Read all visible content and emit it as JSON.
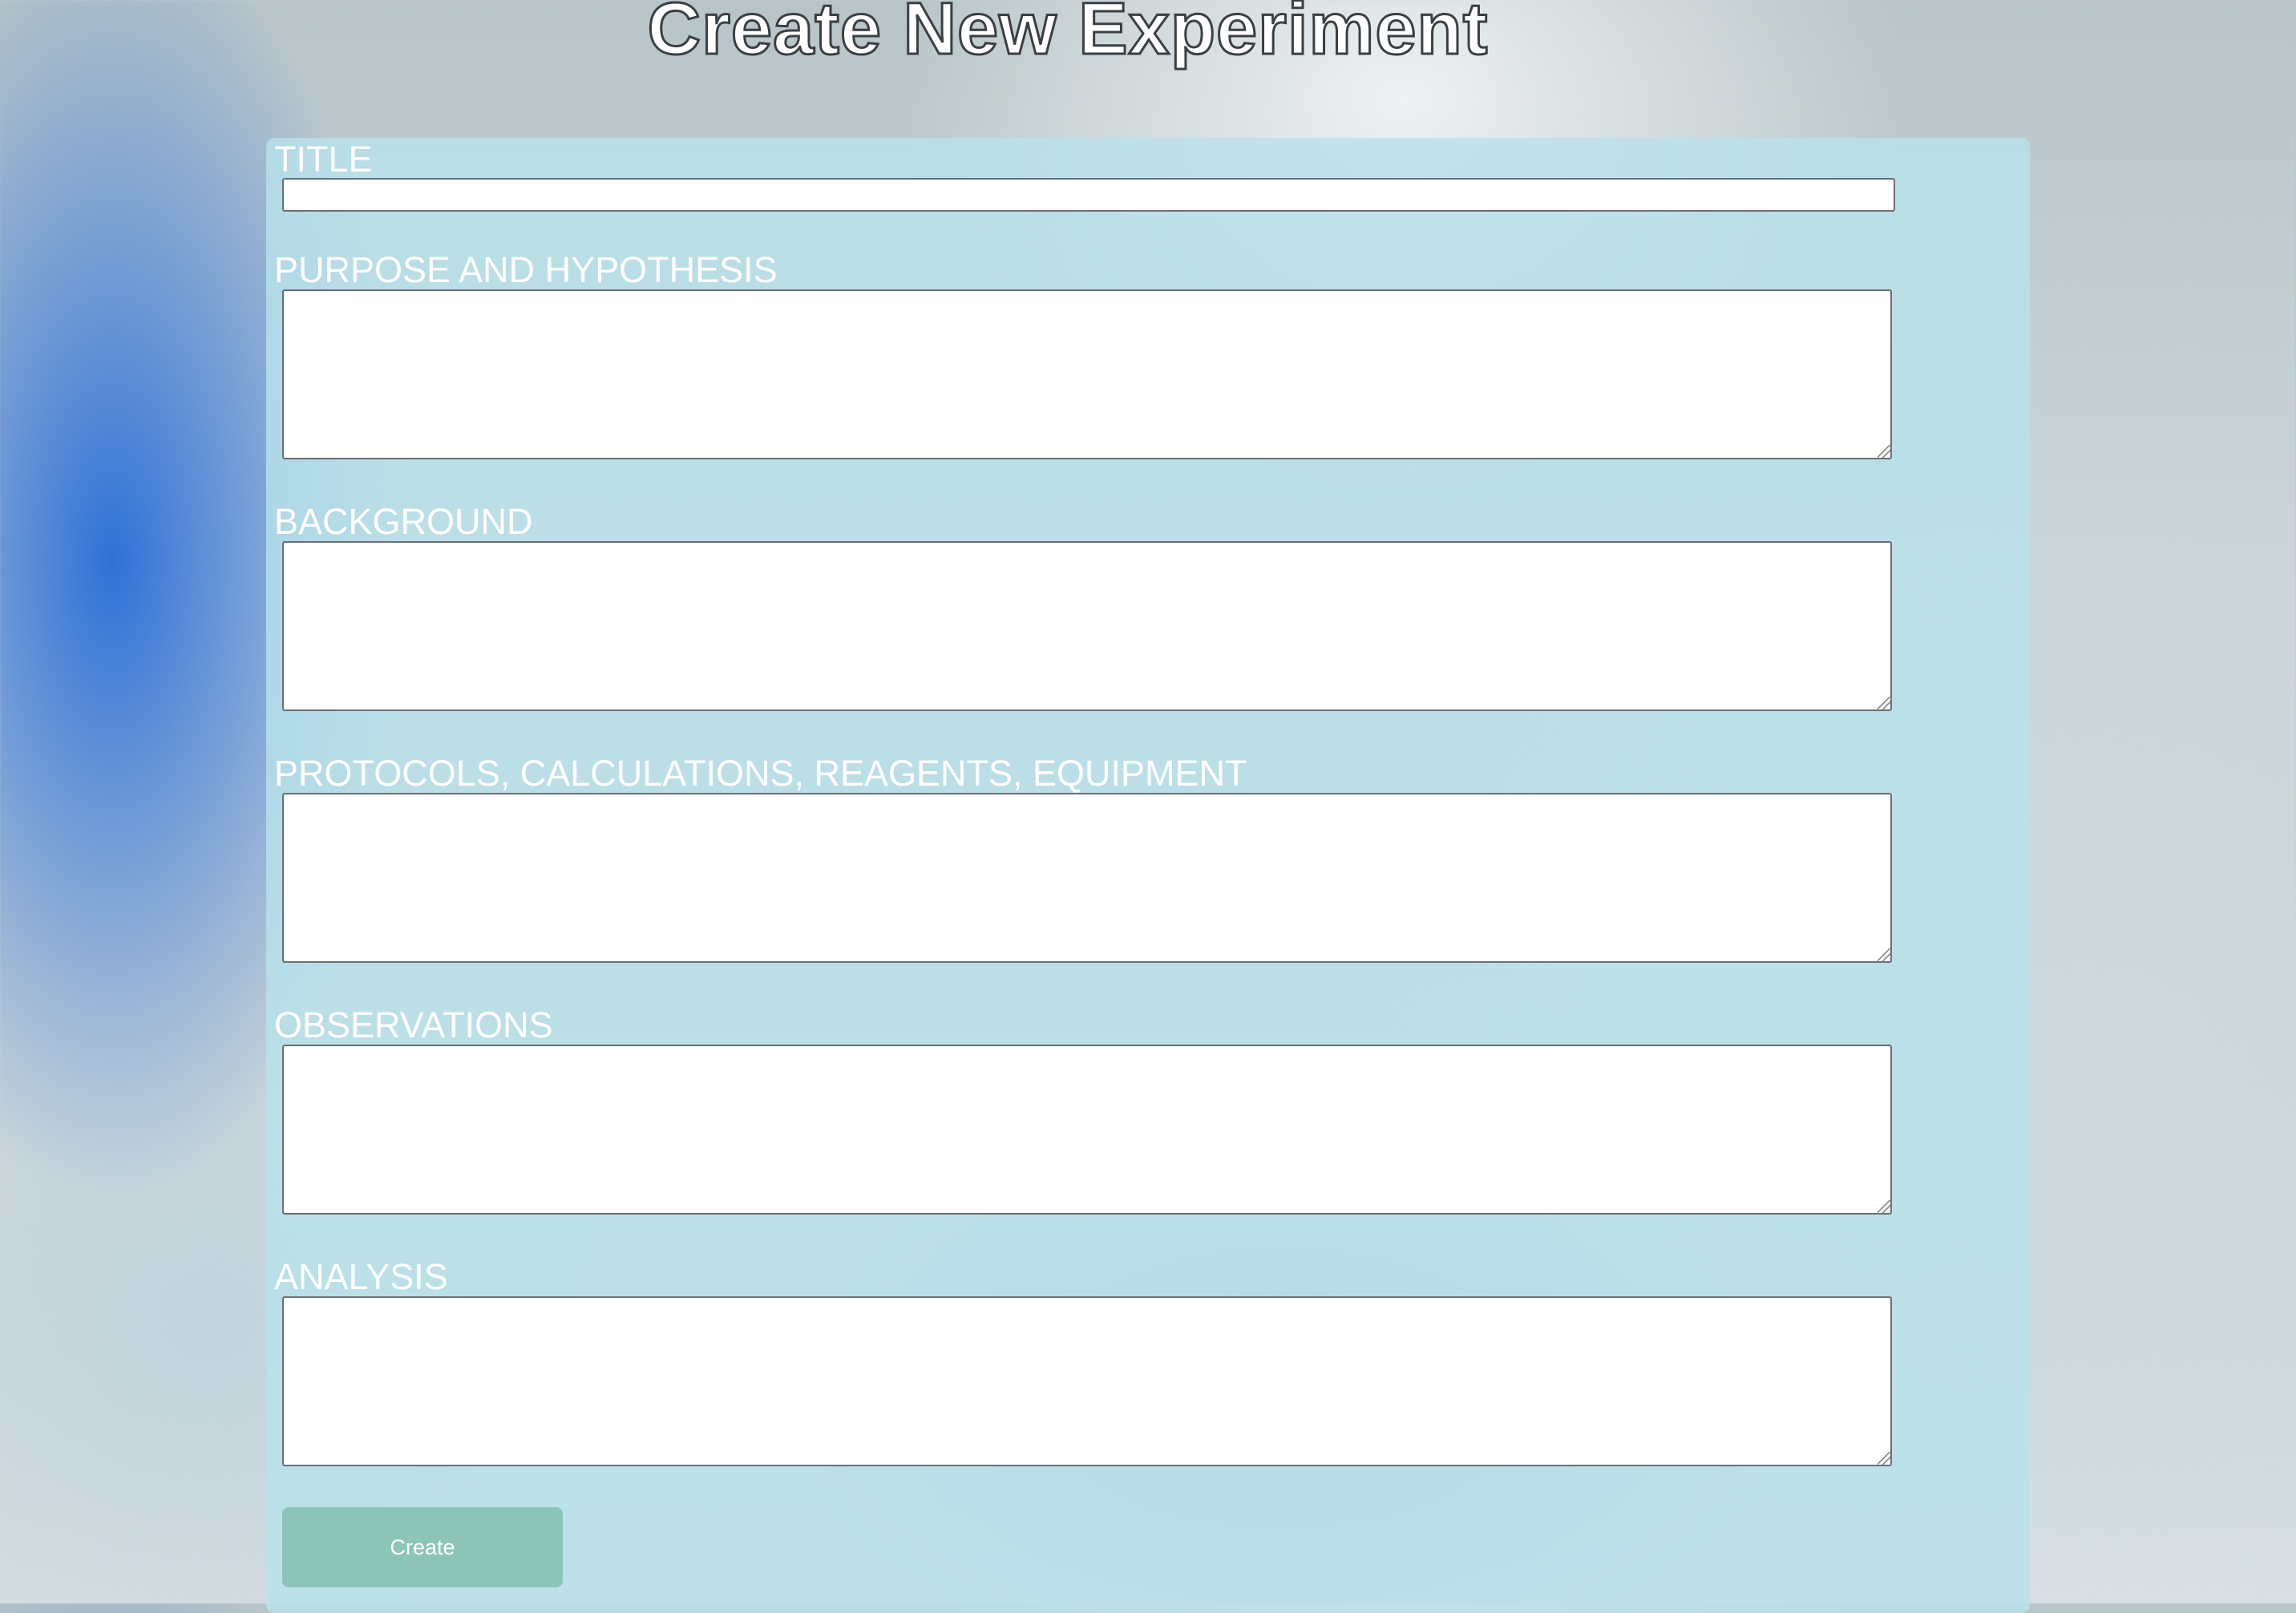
{
  "page": {
    "title": "Create New Experiment"
  },
  "form": {
    "fields": [
      {
        "label": "TITLE",
        "value": ""
      },
      {
        "label": "PURPOSE AND HYPOTHESIS",
        "value": ""
      },
      {
        "label": "BACKGROUND",
        "value": ""
      },
      {
        "label": "PROTOCOLS, CALCULATIONS, REAGENTS, EQUIPMENT",
        "value": ""
      },
      {
        "label": "OBSERVATIONS",
        "value": ""
      },
      {
        "label": "ANALYSIS",
        "value": ""
      }
    ],
    "submit_label": "Create"
  },
  "colors": {
    "panel_background": "#b8e2ea",
    "button_background": "#8cc5b8",
    "label_text": "#ffffff"
  }
}
